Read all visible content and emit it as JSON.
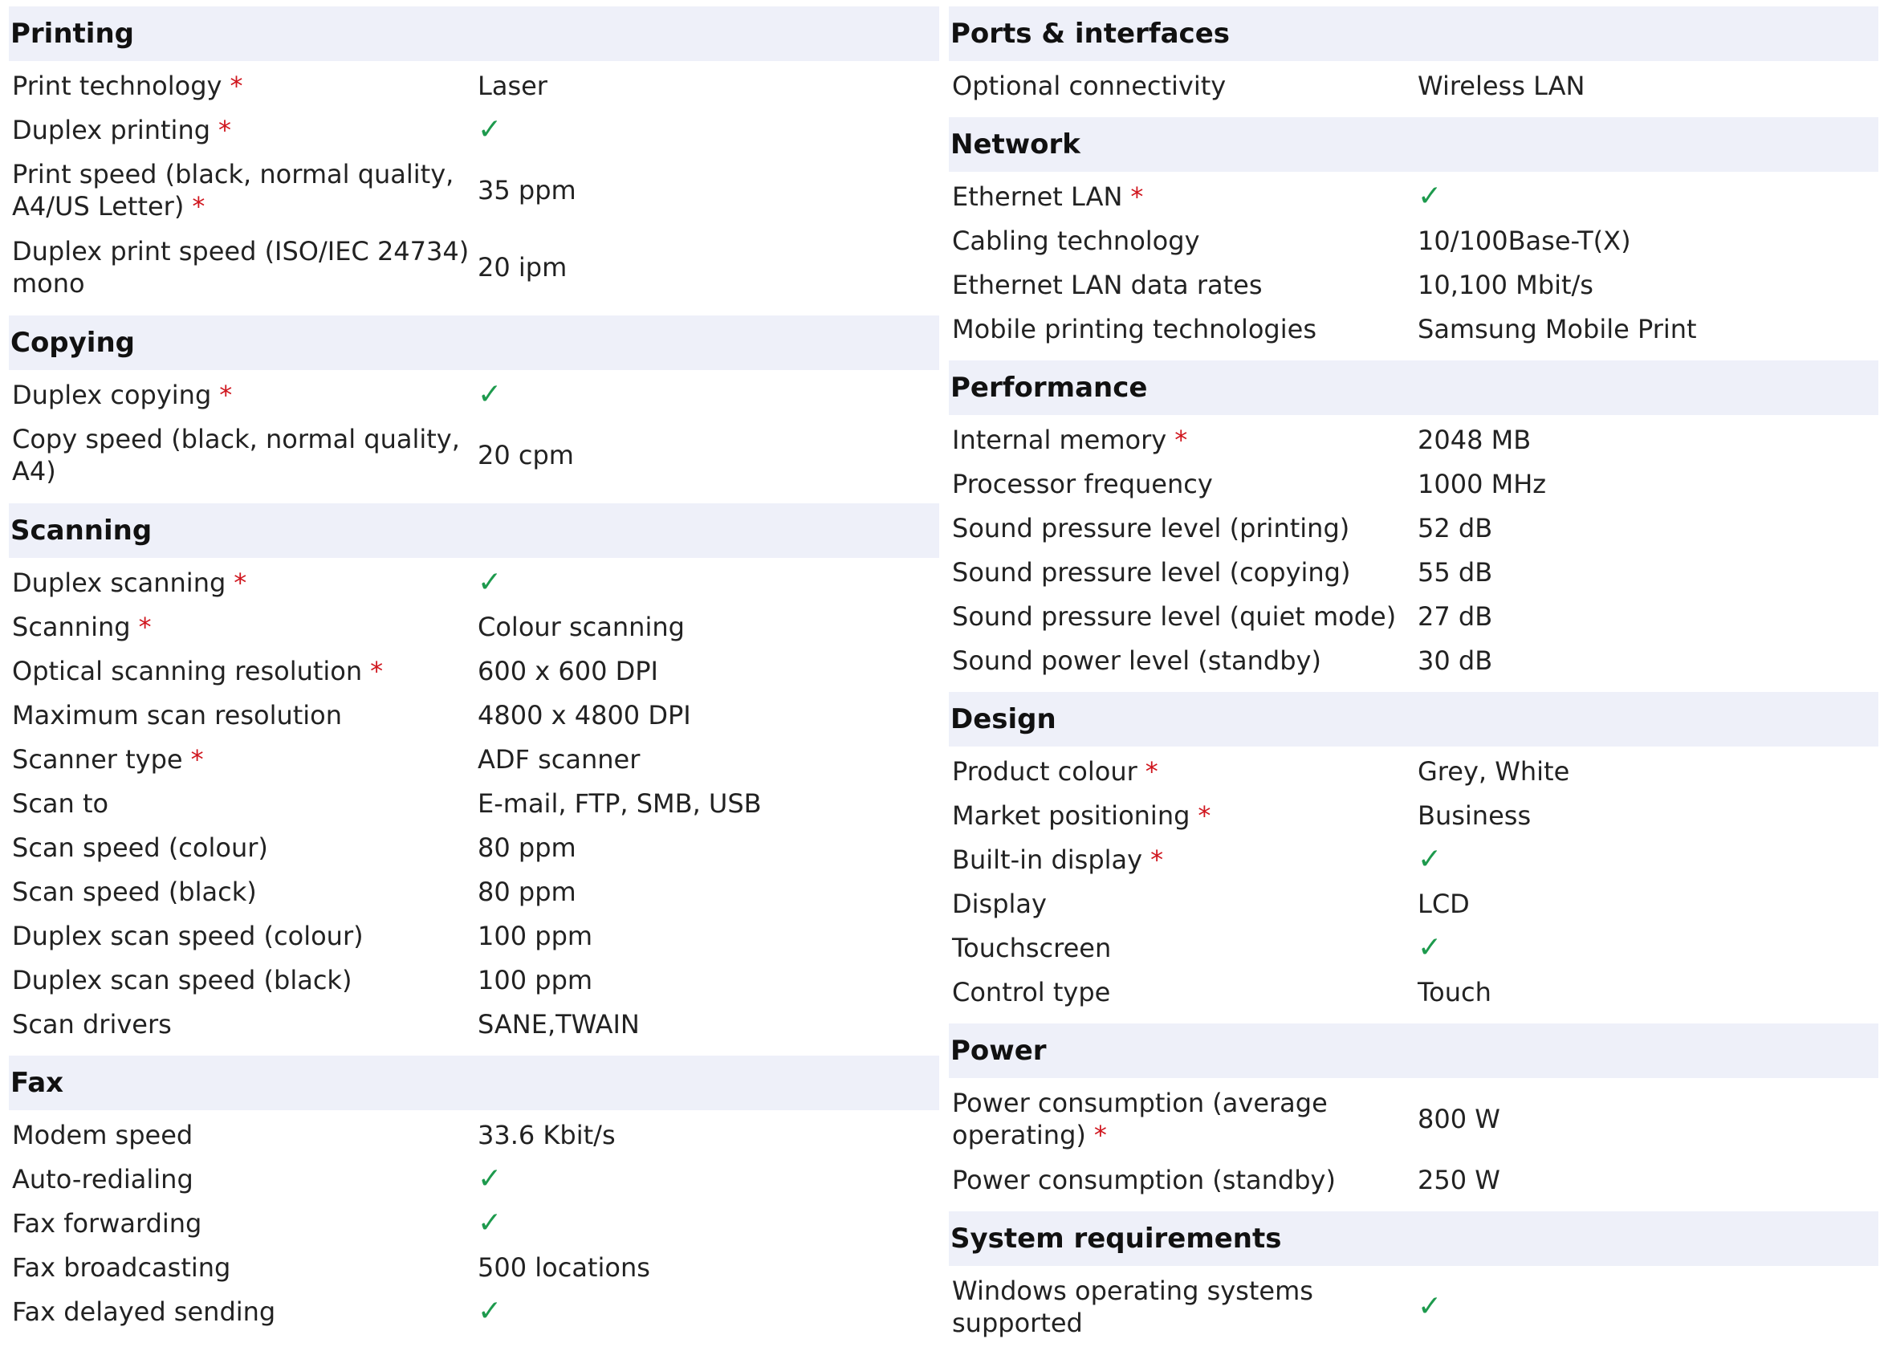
{
  "columns": [
    {
      "sections": [
        {
          "title": "Printing",
          "rows": [
            {
              "label": "Print technology",
              "required": true,
              "value": "Laser"
            },
            {
              "label": "Duplex printing",
              "required": true,
              "value": "✓"
            },
            {
              "label": "Print speed (black, normal quality, A4/US Letter)",
              "required": true,
              "value": "35 ppm"
            },
            {
              "label": "Duplex print speed (ISO/IEC 24734) mono",
              "required": false,
              "value": "20 ipm"
            }
          ]
        },
        {
          "title": "Copying",
          "rows": [
            {
              "label": "Duplex copying",
              "required": true,
              "value": "✓"
            },
            {
              "label": "Copy speed (black, normal quality, A4)",
              "required": false,
              "value": "20 cpm"
            }
          ]
        },
        {
          "title": "Scanning",
          "rows": [
            {
              "label": "Duplex scanning",
              "required": true,
              "value": "✓"
            },
            {
              "label": "Scanning",
              "required": true,
              "value": "Colour scanning"
            },
            {
              "label": "Optical scanning resolution",
              "required": true,
              "value": "600 x 600 DPI"
            },
            {
              "label": "Maximum scan resolution",
              "required": false,
              "value": "4800 x 4800 DPI"
            },
            {
              "label": "Scanner type",
              "required": true,
              "value": "ADF scanner"
            },
            {
              "label": "Scan to",
              "required": false,
              "value": "E-mail, FTP, SMB, USB"
            },
            {
              "label": "Scan speed (colour)",
              "required": false,
              "value": "80 ppm"
            },
            {
              "label": "Scan speed (black)",
              "required": false,
              "value": "80 ppm"
            },
            {
              "label": "Duplex scan speed (colour)",
              "required": false,
              "value": "100 ppm"
            },
            {
              "label": "Duplex scan speed (black)",
              "required": false,
              "value": "100 ppm"
            },
            {
              "label": "Scan drivers",
              "required": false,
              "value": "SANE,TWAIN"
            }
          ]
        },
        {
          "title": "Fax",
          "rows": [
            {
              "label": "Modem speed",
              "required": false,
              "value": "33.6 Kbit/s"
            },
            {
              "label": "Auto-redialing",
              "required": false,
              "value": "✓"
            },
            {
              "label": "Fax forwarding",
              "required": false,
              "value": "✓"
            },
            {
              "label": "Fax broadcasting",
              "required": false,
              "value": "500 locations"
            },
            {
              "label": "Fax delayed sending",
              "required": false,
              "value": "✓"
            }
          ]
        }
      ]
    },
    {
      "sections": [
        {
          "title": "Ports & interfaces",
          "rows": [
            {
              "label": "Optional connectivity",
              "required": false,
              "value": "Wireless LAN"
            }
          ]
        },
        {
          "title": "Network",
          "rows": [
            {
              "label": "Ethernet LAN",
              "required": true,
              "value": "✓"
            },
            {
              "label": "Cabling technology",
              "required": false,
              "value": "10/100Base-T(X)"
            },
            {
              "label": "Ethernet LAN data rates",
              "required": false,
              "value": "10,100 Mbit/s"
            },
            {
              "label": "Mobile printing technologies",
              "required": false,
              "value": "Samsung Mobile Print"
            }
          ]
        },
        {
          "title": "Performance",
          "rows": [
            {
              "label": "Internal memory",
              "required": true,
              "value": "2048 MB"
            },
            {
              "label": "Processor frequency",
              "required": false,
              "value": "1000 MHz"
            },
            {
              "label": "Sound pressure level (printing)",
              "required": false,
              "value": "52 dB"
            },
            {
              "label": "Sound pressure level (copying)",
              "required": false,
              "value": "55 dB"
            },
            {
              "label": "Sound pressure level (quiet mode)",
              "required": false,
              "value": "27 dB"
            },
            {
              "label": "Sound power level (standby)",
              "required": false,
              "value": "30 dB"
            }
          ]
        },
        {
          "title": "Design",
          "rows": [
            {
              "label": "Product colour",
              "required": true,
              "value": "Grey, White"
            },
            {
              "label": "Market positioning",
              "required": true,
              "value": "Business"
            },
            {
              "label": "Built-in display",
              "required": true,
              "value": "✓"
            },
            {
              "label": "Display",
              "required": false,
              "value": "LCD"
            },
            {
              "label": "Touchscreen",
              "required": false,
              "value": "✓"
            },
            {
              "label": "Control type",
              "required": false,
              "value": "Touch"
            }
          ]
        },
        {
          "title": "Power",
          "rows": [
            {
              "label": "Power consumption (average operating)",
              "required": true,
              "value": "800 W"
            },
            {
              "label": "Power consumption (standby)",
              "required": false,
              "value": "250 W"
            }
          ]
        },
        {
          "title": "System requirements",
          "rows": [
            {
              "label": "Windows operating systems supported",
              "required": false,
              "value": "✓"
            }
          ]
        }
      ]
    }
  ],
  "required_marker": "*",
  "colors": {
    "header_bg": "#eef0f9",
    "check": "#1d9a4d",
    "required": "#d0161e"
  }
}
